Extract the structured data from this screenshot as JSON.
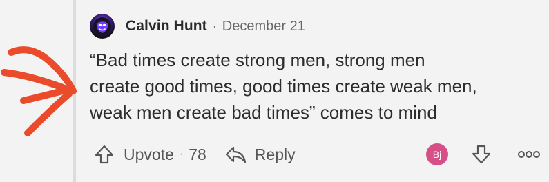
{
  "comment": {
    "author": "Calvin Hunt",
    "date": "December 21",
    "separator": "·",
    "lines": [
      "“Bad times create strong men, strong men",
      "create good times, good times create weak men,",
      "weak men create bad times” comes to mind"
    ]
  },
  "actions": {
    "upvote_label": "Upvote",
    "separator": "·",
    "upvote_count": "78",
    "reply_label": "Reply",
    "badge_text": "Bj"
  },
  "icons": {
    "avatar_icon": "masked-face-icon",
    "upvote_icon": "upvote-arrow-icon",
    "reply_icon": "reply-arrow-icon",
    "downvote_icon": "downvote-arrow-icon",
    "more_icon": "more-options-icon",
    "annotation": "red-hand-drawn-arrow"
  },
  "colors": {
    "background": "#f3f3f3",
    "text": "#2d2d2d",
    "muted": "#666666",
    "accent_badge": "#d64f87",
    "annotation_red": "#ea4b2a"
  }
}
